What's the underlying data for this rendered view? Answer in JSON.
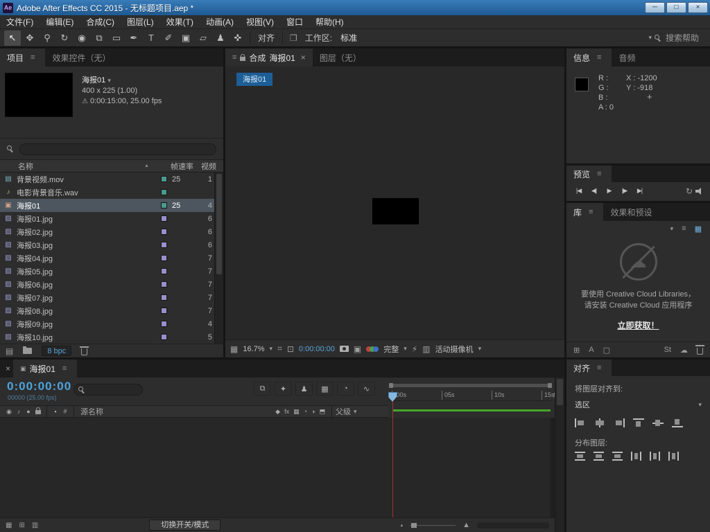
{
  "window": {
    "app_badge": "Ae",
    "title": "Adobe After Effects CC 2015 - 无标题项目.aep *"
  },
  "menubar": [
    "文件(F)",
    "编辑(E)",
    "合成(C)",
    "图层(L)",
    "效果(T)",
    "动画(A)",
    "视图(V)",
    "窗口",
    "帮助(H)"
  ],
  "toolbar": {
    "tools": [
      "selection",
      "hand",
      "zoom",
      "rotate",
      "camera",
      "pan-behind",
      "rectangle",
      "pen",
      "type",
      "brush",
      "clone-stamp",
      "eraser",
      "roto-brush",
      "puppet-pin"
    ],
    "snap_label": "对齐",
    "workspace_label": "工作区:",
    "workspace_value": "标准",
    "search_placeholder": "搜索帮助"
  },
  "project": {
    "tabs": {
      "project": "项目",
      "effect_controls": "效果控件（无）"
    },
    "selected_info": {
      "name": "海报01",
      "dimensions": "400 x 225 (1.00)",
      "duration": "0:00:15:00, 25.00 fps"
    },
    "columns": {
      "name": "名称",
      "frame_rate": "帧速率",
      "video": "视频"
    },
    "items": [
      {
        "name": "背景视频.mov",
        "type": "movie",
        "rate": "25",
        "count": "1",
        "label": "#4a9a8e",
        "selected": false
      },
      {
        "name": "电影背景音乐.wav",
        "type": "audio",
        "rate": "",
        "count": "",
        "label": "#4a9a8e",
        "selected": false
      },
      {
        "name": "海报01",
        "type": "comp",
        "rate": "25",
        "count": "4",
        "label": "#4a9a8e",
        "selected": true
      },
      {
        "name": "海报01.jpg",
        "type": "image",
        "rate": "",
        "count": "6",
        "label": "#9a90cc",
        "selected": false
      },
      {
        "name": "海报02.jpg",
        "type": "image",
        "rate": "",
        "count": "6",
        "label": "#9a90cc",
        "selected": false
      },
      {
        "name": "海报03.jpg",
        "type": "image",
        "rate": "",
        "count": "6",
        "label": "#9a90cc",
        "selected": false
      },
      {
        "name": "海报04.jpg",
        "type": "image",
        "rate": "",
        "count": "7",
        "label": "#9a90cc",
        "selected": false
      },
      {
        "name": "海报05.jpg",
        "type": "image",
        "rate": "",
        "count": "7",
        "label": "#9a90cc",
        "selected": false
      },
      {
        "name": "海报06.jpg",
        "type": "image",
        "rate": "",
        "count": "7",
        "label": "#9a90cc",
        "selected": false
      },
      {
        "name": "海报07.jpg",
        "type": "image",
        "rate": "",
        "count": "7",
        "label": "#9a90cc",
        "selected": false
      },
      {
        "name": "海报08.jpg",
        "type": "image",
        "rate": "",
        "count": "7",
        "label": "#9a90cc",
        "selected": false
      },
      {
        "name": "海报09.jpg",
        "type": "image",
        "rate": "",
        "count": "4",
        "label": "#9a90cc",
        "selected": false
      },
      {
        "name": "海报10.jpg",
        "type": "image",
        "rate": "",
        "count": "5",
        "label": "#9a90cc",
        "selected": false
      }
    ],
    "bpc": "8 bpc"
  },
  "comp": {
    "tabs": {
      "composition": "合成",
      "comp_name": "海报01",
      "layer": "图层（无）"
    },
    "viewer_button": "海报01",
    "zoom": "16.7%",
    "timecode": "0:00:00:00",
    "resolution": "完整",
    "view_name": "活动摄像机"
  },
  "info": {
    "tabs": {
      "info": "信息",
      "audio": "音频"
    },
    "r": "R :",
    "g": "G :",
    "b": "B :",
    "a": "A : 0",
    "x": "X : -1200",
    "y": "Y : -918"
  },
  "preview": {
    "title": "预览",
    "buttons": [
      "first-frame",
      "previous-frame",
      "play",
      "next-frame",
      "last-frame"
    ]
  },
  "libraries": {
    "tabs": {
      "library": "库",
      "effects_presets": "效果和预设"
    },
    "message_line1": "要使用 Creative Cloud Libraries，",
    "message_line2": "请安装 Creative Cloud 应用程序",
    "cta": "立即获取！"
  },
  "align": {
    "title": "对齐",
    "align_to_label": "将图层对齐到:",
    "align_to_value": "选区",
    "distribute_label": "分布图层:"
  },
  "timeline": {
    "tab": "海报01",
    "timecode": "0:00:00:00",
    "frame_counter": "00000 (25.00 fps)",
    "toggles": [
      "comp-mini-flowchart",
      "draft-3d",
      "hide-shy-layers",
      "frame-blending",
      "motion-blur",
      "graph-editor"
    ],
    "columns": {
      "source_name": "源名称",
      "parent": "父级"
    },
    "switches": [
      "quality",
      "effects",
      "frame-blend",
      "motion-blur",
      "adjustment-layer",
      "3d-layer"
    ],
    "ruler": [
      ":00s",
      "05s",
      "10s",
      "15s"
    ],
    "modes_button": "切换开关/模式"
  }
}
